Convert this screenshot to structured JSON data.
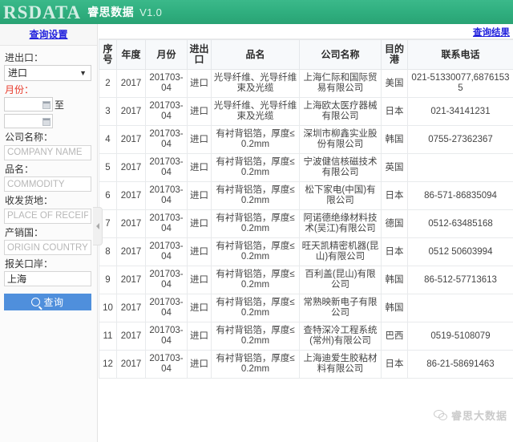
{
  "header": {
    "logo_text": "RSDATA",
    "title": "睿思数据",
    "version": "V1.0"
  },
  "sidebar": {
    "tab_label": "查询设置",
    "fields": {
      "trade_direction": {
        "label": "进出口：",
        "value": "进口",
        "caret": "chevron-down-icon"
      },
      "month": {
        "label": "月份：",
        "from_value": "",
        "to_value": "",
        "separator": "至"
      },
      "company": {
        "label": "公司名称：",
        "placeholder": "COMPANY NAME",
        "value": ""
      },
      "commodity": {
        "label": "品名：",
        "placeholder": "COMMODITY",
        "value": ""
      },
      "place_of_receipt": {
        "label": "收发货地：",
        "placeholder": "PLACE OF RECEIPT",
        "value": ""
      },
      "origin_country": {
        "label": "产销国：",
        "placeholder": "ORIGIN COUNTRY",
        "value": ""
      },
      "customs_port": {
        "label": "报关口岸：",
        "placeholder": "",
        "value": "上海"
      }
    },
    "search_button": "查询",
    "search_icon": "search-icon",
    "collapse_icon": "chevron-left-icon"
  },
  "results": {
    "tab_label": "查询结果",
    "columns": [
      "序号",
      "年度",
      "月份",
      "进出口",
      "品名",
      "公司名称",
      "目的港",
      "联系电话"
    ],
    "rows": [
      {
        "idx": "2",
        "year": "2017",
        "month": "201703-04",
        "ie": "进口",
        "commodity": "光导纤维、光导纤维束及光缆",
        "company": "上海仁际和国际贸易有限公司",
        "port": "美国",
        "tel": "021-51330077,68761535"
      },
      {
        "idx": "3",
        "year": "2017",
        "month": "201703-04",
        "ie": "进口",
        "commodity": "光导纤维、光导纤维束及光缆",
        "company": "上海欧太医疗器械有限公司",
        "port": "日本",
        "tel": "021-34141231"
      },
      {
        "idx": "4",
        "year": "2017",
        "month": "201703-04",
        "ie": "进口",
        "commodity": "有衬背铝箔，厚度≤0.2mm",
        "company": "深圳市柳鑫实业股份有限公司",
        "port": "韩国",
        "tel": "0755-27362367"
      },
      {
        "idx": "5",
        "year": "2017",
        "month": "201703-04",
        "ie": "进口",
        "commodity": "有衬背铝箔，厚度≤0.2mm",
        "company": "宁波健信核磁技术有限公司",
        "port": "英国",
        "tel": ""
      },
      {
        "idx": "6",
        "year": "2017",
        "month": "201703-04",
        "ie": "进口",
        "commodity": "有衬背铝箔，厚度≤0.2mm",
        "company": "松下家电(中国)有限公司",
        "port": "日本",
        "tel": "86-571-86835094"
      },
      {
        "idx": "7",
        "year": "2017",
        "month": "201703-04",
        "ie": "进口",
        "commodity": "有衬背铝箔，厚度≤0.2mm",
        "company": "阿诺德绝缘材料技术(吴江)有限公司",
        "port": "德国",
        "tel": "0512-63485168"
      },
      {
        "idx": "8",
        "year": "2017",
        "month": "201703-04",
        "ie": "进口",
        "commodity": "有衬背铝箔，厚度≤0.2mm",
        "company": "旺天凯精密机器(昆山)有限公司",
        "port": "日本",
        "tel": "0512 50603994"
      },
      {
        "idx": "9",
        "year": "2017",
        "month": "201703-04",
        "ie": "进口",
        "commodity": "有衬背铝箔，厚度≤0.2mm",
        "company": "百利盖(昆山)有限公司",
        "port": "韩国",
        "tel": "86-512-57713613"
      },
      {
        "idx": "10",
        "year": "2017",
        "month": "201703-04",
        "ie": "进口",
        "commodity": "有衬背铝箔，厚度≤0.2mm",
        "company": "常熟映新电子有限公司",
        "port": "韩国",
        "tel": ""
      },
      {
        "idx": "11",
        "year": "2017",
        "month": "201703-04",
        "ie": "进口",
        "commodity": "有衬背铝箔，厚度≤0.2mm",
        "company": "查特深冷工程系统(常州)有限公司",
        "port": "巴西",
        "tel": "0519-5108079"
      },
      {
        "idx": "12",
        "year": "2017",
        "month": "201703-04",
        "ie": "进口",
        "commodity": "有衬背铝箔，厚度≤0.2mm",
        "company": "上海迪爱生胶粘材料有限公司",
        "port": "日本",
        "tel": "86-21-58691463"
      }
    ]
  },
  "watermark": {
    "text": "睿思大数据",
    "icon": "wechat-icon"
  },
  "colors": {
    "header_green": "#2fae7e",
    "link_blue": "#2222dd",
    "button_blue": "#4f8fdc",
    "required_red": "#e8392a"
  }
}
